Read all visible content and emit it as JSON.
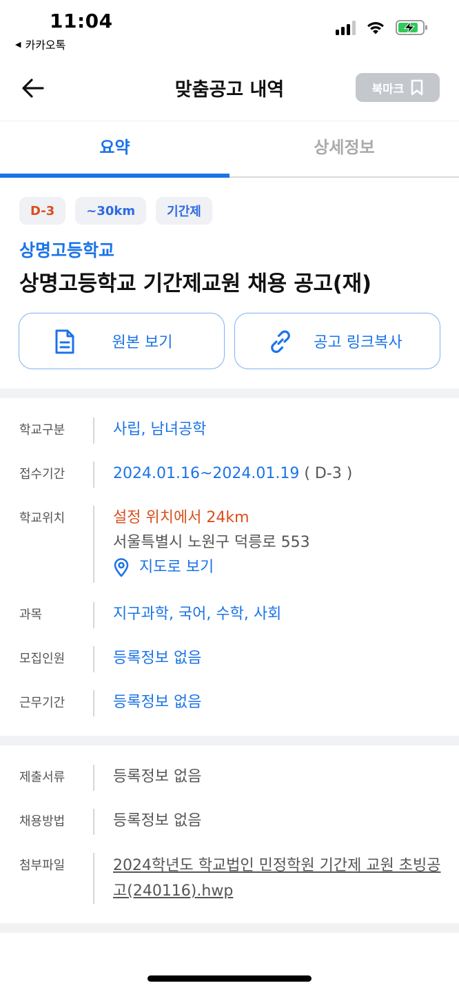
{
  "status_bar": {
    "time": "11:04",
    "back_app": "카카오톡"
  },
  "header": {
    "title": "맞춤공고 내역",
    "bookmark_label": "북마크"
  },
  "tabs": [
    {
      "label": "요약",
      "active": true
    },
    {
      "label": "상세정보",
      "active": false
    }
  ],
  "summary": {
    "chips": [
      {
        "label": "D-3",
        "color": "#d94f1e"
      },
      {
        "label": "~30km",
        "color": "#2d6ae3"
      },
      {
        "label": "기간제",
        "color": "#2d6ae3"
      }
    ],
    "school_name": "상명고등학교",
    "notice_title": "상명고등학교 기간제교원 채용 공고(재)",
    "view_original_label": "원본 보기",
    "copy_link_label": "공고 링크복사"
  },
  "info": {
    "school_type": {
      "label": "학교구분",
      "value": "사립, 남녀공학"
    },
    "period": {
      "label": "접수기간",
      "value": "2024.01.16~2024.01.19",
      "dday": "( D-3 )"
    },
    "location": {
      "label": "학교위치",
      "distance": "설정 위치에서 24km",
      "address": "서울특별시 노원구 덕릉로 553",
      "map_label": "지도로 보기"
    },
    "subjects": {
      "label": "과목",
      "value": "지구과학, 국어, 수학, 사회"
    },
    "recruit_count": {
      "label": "모집인원",
      "value": "등록정보 없음"
    },
    "work_period": {
      "label": "근무기간",
      "value": "등록정보 없음"
    }
  },
  "extra": {
    "documents": {
      "label": "제출서류",
      "value": "등록정보 없음"
    },
    "method": {
      "label": "채용방법",
      "value": "등록정보 없음"
    },
    "attachment": {
      "label": "첨부파일",
      "value": "2024학년도 학교법인 민정학원 기간제 교원 초빙공고(240116).hwp"
    }
  },
  "colors": {
    "accent": "#1a73e8",
    "alert": "#d94f1e",
    "bookmark_bg": "#c4c7cc"
  }
}
